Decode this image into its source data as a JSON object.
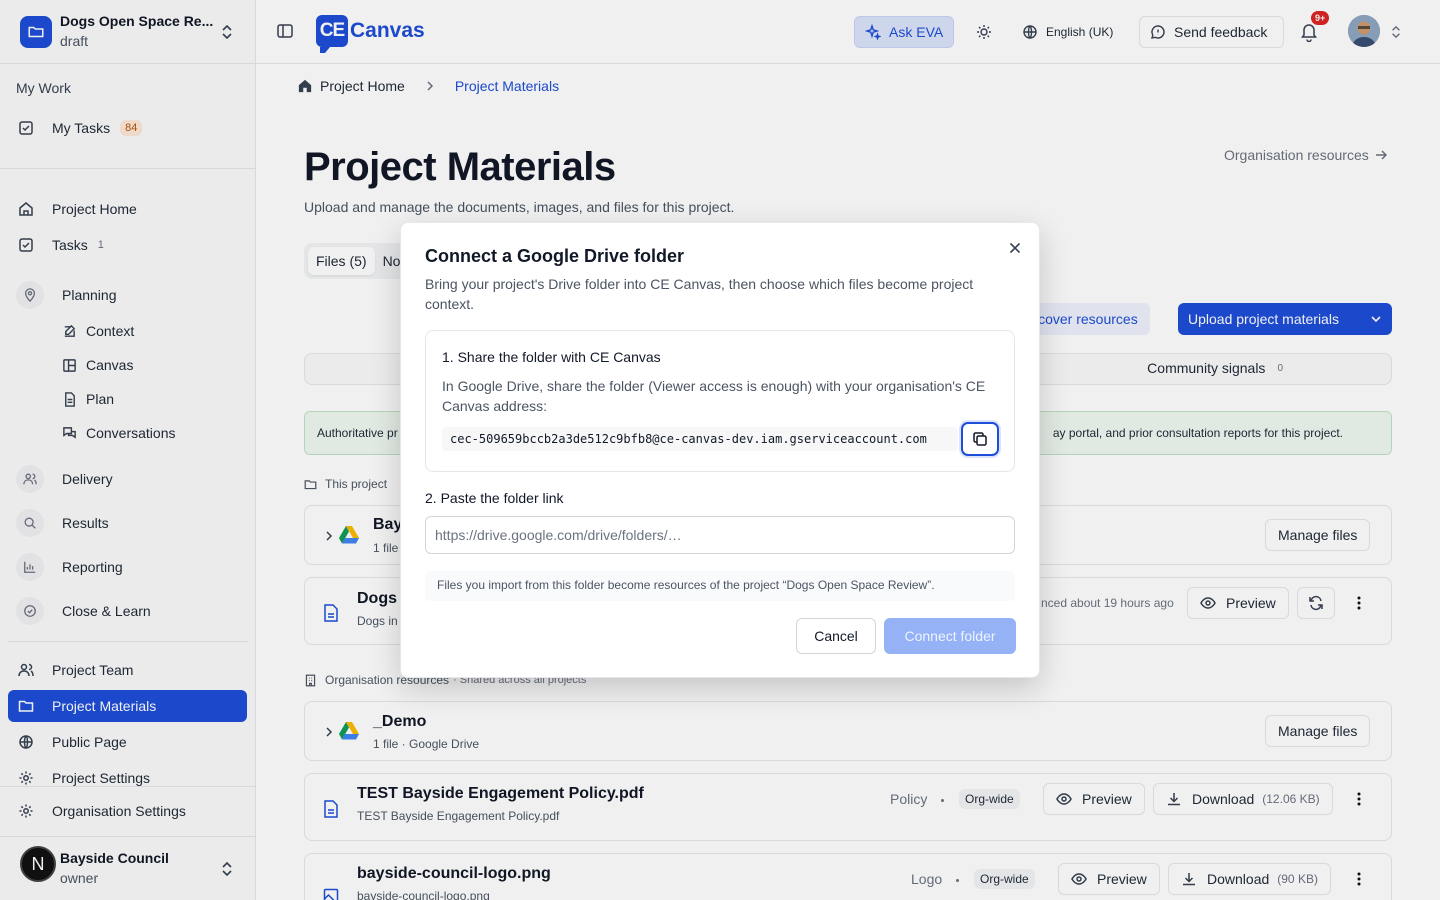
{
  "project": {
    "name": "Dogs Open Space Re...",
    "status": "draft"
  },
  "sidebar": {
    "my_work_label": "My Work",
    "my_tasks": {
      "label": "My Tasks",
      "count": "84"
    },
    "project_home": "Project Home",
    "tasks": {
      "label": "Tasks",
      "count": "1"
    },
    "planning": "Planning",
    "planning_items": [
      "Context",
      "Canvas",
      "Plan",
      "Conversations"
    ],
    "delivery": "Delivery",
    "results": "Results",
    "reporting": "Reporting",
    "close_learn": "Close & Learn",
    "project_team": "Project Team",
    "project_materials": "Project Materials",
    "public_page": "Public Page",
    "project_settings": "Project Settings",
    "organisation_settings": "Organisation Settings",
    "org": {
      "initial": "N",
      "name": "Bayside Council",
      "role": "owner"
    }
  },
  "topbar": {
    "logo_mark": "CE",
    "logo_text": "Canvas",
    "ask_eva": "Ask EVA",
    "language": "English (UK)",
    "send_feedback": "Send feedback",
    "notifications": "9+"
  },
  "breadcrumb": {
    "home": "Project Home",
    "current": "Project Materials"
  },
  "page": {
    "title": "Project Materials",
    "subtitle": "Upload and manage the documents, images, and files for this project.",
    "org_resources_link": "Organisation resources",
    "tabs": [
      "Files (5)",
      "No"
    ],
    "discover_button": "iscover resources",
    "upload_button": "Upload project materials",
    "community_signals": {
      "label": "Community signals",
      "count": "0"
    },
    "banner_left": "Authoritative pr",
    "banner_right": "ay portal, and prior consultation reports for this project.",
    "section_this_project": "This project",
    "section_org": "Organisation resources",
    "section_org_note": "· Shared across all projects",
    "rows": {
      "bay": {
        "title": "Bay",
        "sub": "1 file",
        "action": "Manage files"
      },
      "dogs": {
        "title": "Dogs",
        "sub": "Dogs in",
        "synced": "nced about 19 hours ago",
        "preview": "Preview"
      },
      "demo": {
        "title": "_Demo",
        "sub": "1 file · Google Drive",
        "action": "Manage files"
      },
      "policy": {
        "title": "TEST Bayside Engagement Policy.pdf",
        "sub": "TEST Bayside Engagement Policy.pdf",
        "tag": "Policy",
        "scope": "Org-wide",
        "preview": "Preview",
        "download": "Download",
        "size": "(12.06 KB)"
      },
      "logo": {
        "title": "bayside-council-logo.png",
        "sub": "bayside-council-logo.png",
        "tag": "Logo",
        "scope": "Org-wide",
        "preview": "Preview",
        "download": "Download",
        "size": "(90 KB)"
      }
    }
  },
  "dialog": {
    "title": "Connect a Google Drive folder",
    "description": "Bring your project's Drive folder into CE Canvas, then choose which files become project context.",
    "step1_title": "1. Share the folder with CE Canvas",
    "step1_desc": "In Google Drive, share the folder (Viewer access is enough) with your organisation's CE Canvas address:",
    "service_email": "cec-509659bccb2a3de512c9bfb8@ce-canvas-dev.iam.gserviceaccount.com",
    "step2_title": "2. Paste the folder link",
    "link_placeholder": "https://drive.google.com/drive/folders/…",
    "link_value": "",
    "note": "Files you import from this folder become resources of the project “Dogs Open Space Review”.",
    "cancel": "Cancel",
    "connect": "Connect folder"
  },
  "colors": {
    "accent": "#1e4ed8",
    "connect_disabled": "#94b2f5"
  }
}
